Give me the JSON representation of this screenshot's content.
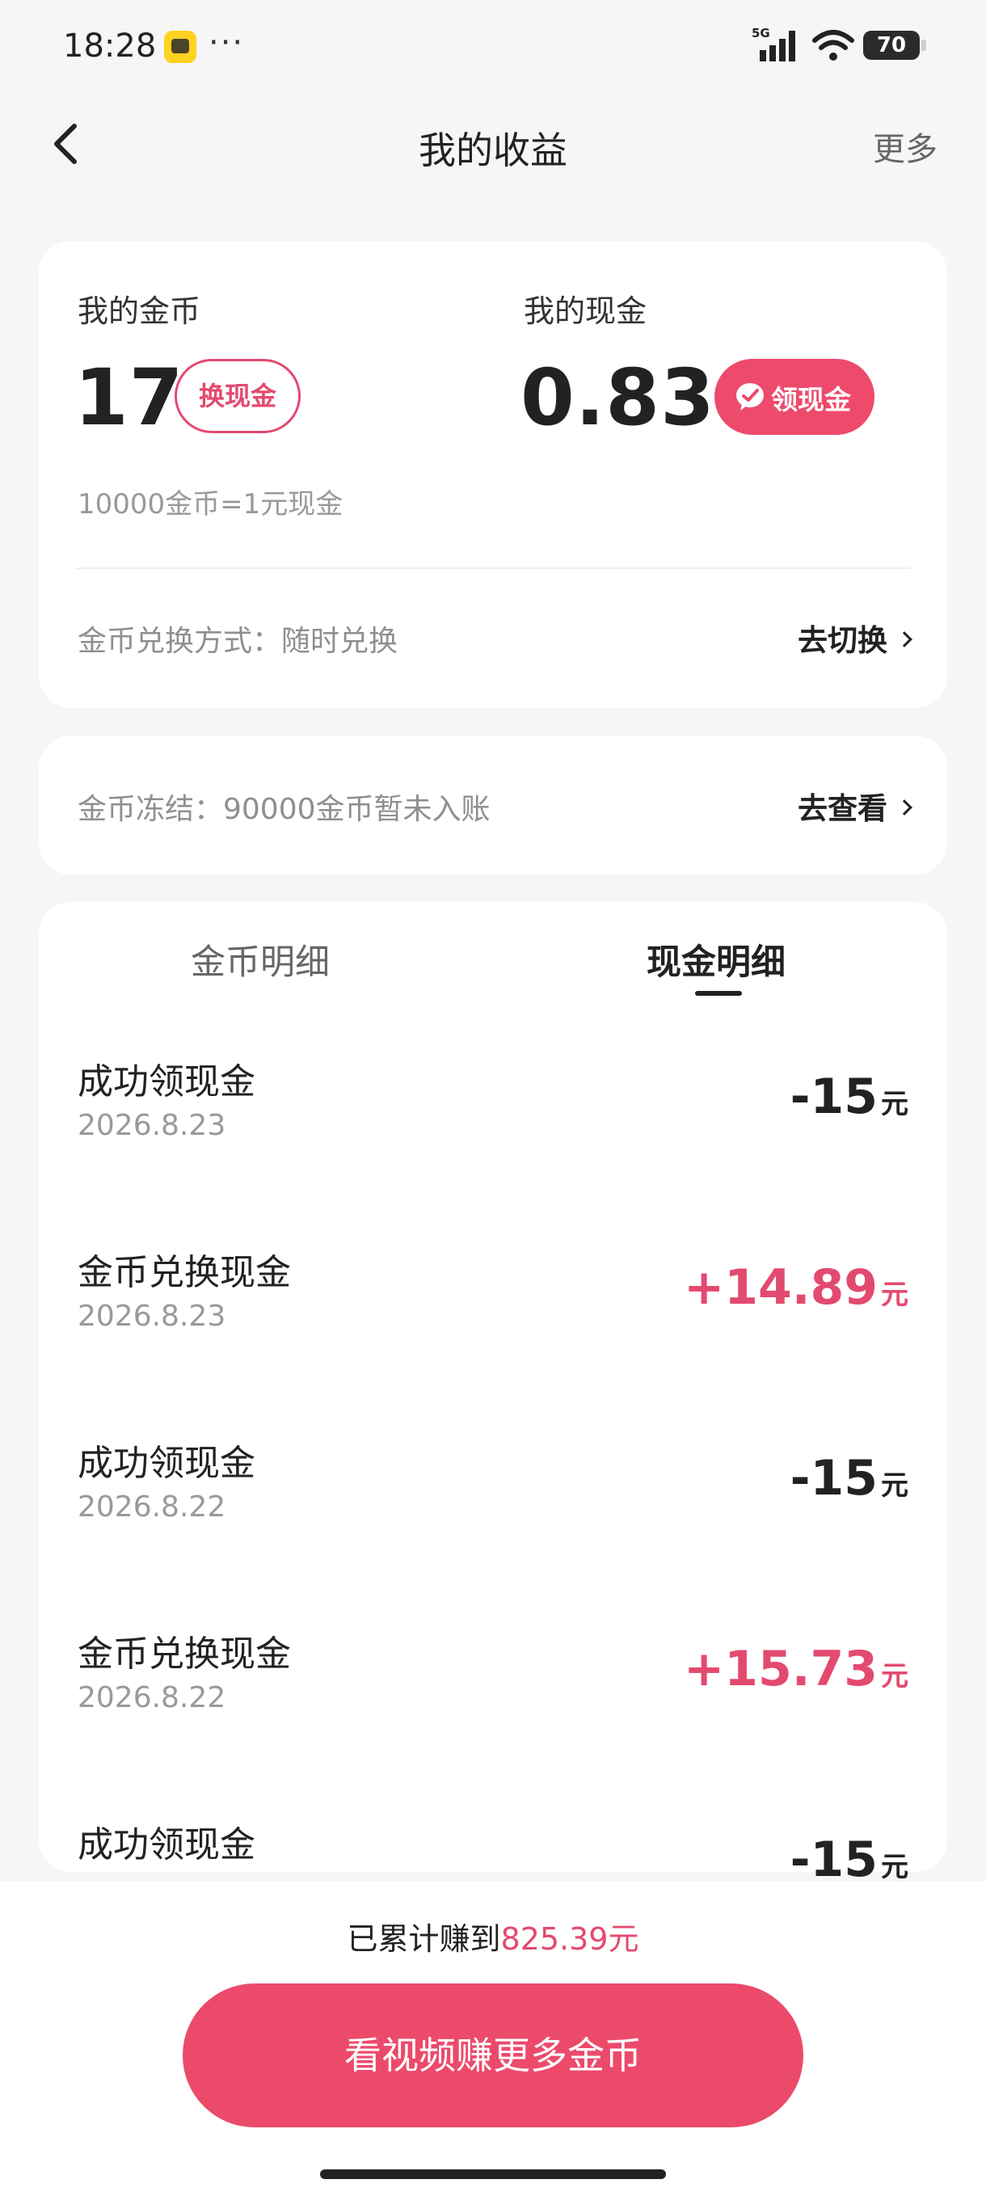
{
  "status_bar": {
    "time": "18:28",
    "app_icon": "app-badge-icon",
    "overflow": "···",
    "network": "5G",
    "battery": "70"
  },
  "header": {
    "back_icon": "back-arrow-icon",
    "title": "我的收益",
    "more": "更多"
  },
  "summary": {
    "coins_label": "我的金币",
    "coins_value": "17",
    "exchange_button": "换现金",
    "cash_label": "我的现金",
    "cash_value": "0.83",
    "withdraw_button": "领现金",
    "rate": "10000金币=1元现金",
    "exchange_mode": "金币兑换方式：随时兑换",
    "switch_link": "去切换"
  },
  "frozen": {
    "text": "金币冻结：90000金币暂未入账",
    "view_link": "去查看"
  },
  "tabs": [
    {
      "label": "金币明细",
      "active": false
    },
    {
      "label": "现金明细",
      "active": true
    }
  ],
  "records": [
    {
      "name": "成功领现金",
      "date": "2026.8.23",
      "amount": "-15",
      "unit": "元",
      "type": "neg"
    },
    {
      "name": "金币兑换现金",
      "date": "2026.8.23",
      "amount": "+14.89",
      "unit": "元",
      "type": "pos"
    },
    {
      "name": "成功领现金",
      "date": "2026.8.22",
      "amount": "-15",
      "unit": "元",
      "type": "neg"
    },
    {
      "name": "金币兑换现金",
      "date": "2026.8.22",
      "amount": "+15.73",
      "unit": "元",
      "type": "pos"
    },
    {
      "name": "成功领现金",
      "date": "",
      "amount": "-15",
      "unit": "元",
      "type": "neg"
    }
  ],
  "footer": {
    "total_prefix": "已累计赚到",
    "total_value": "825.39元",
    "cta": "看视频赚更多金币"
  },
  "colors": {
    "accent": "#ec4a6b",
    "background": "#f6f6f6"
  }
}
